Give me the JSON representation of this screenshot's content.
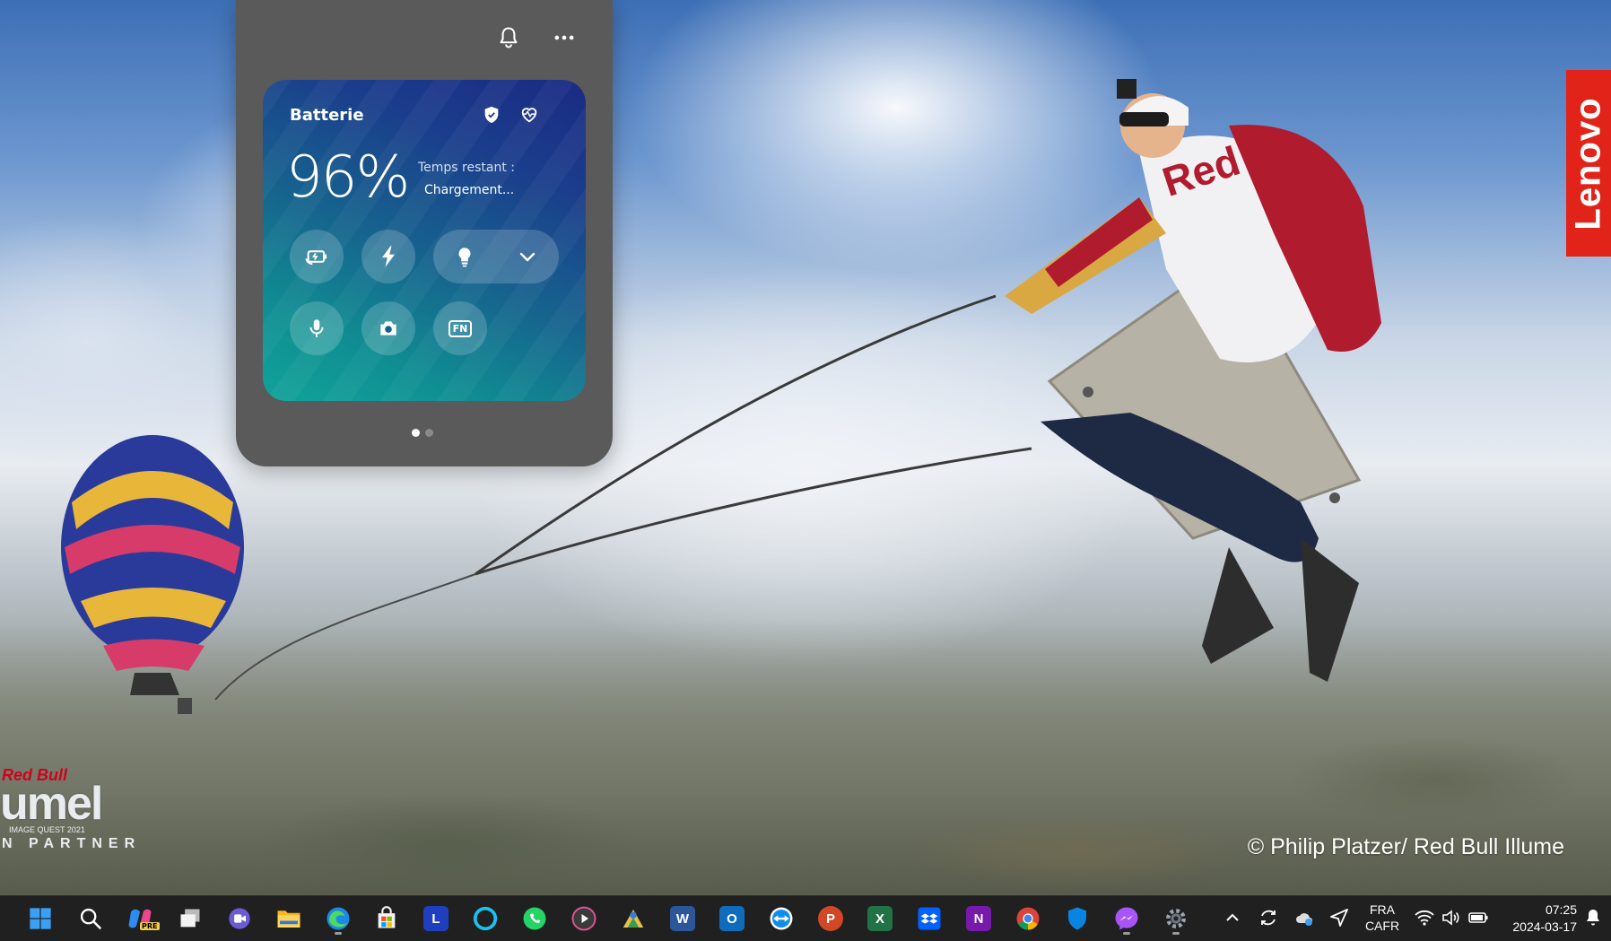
{
  "wallpaper": {
    "brand_tab": "Lenovo",
    "credit": "© Philip Platzer/ Red Bull Illume",
    "logo": {
      "brand": "Red Bull",
      "word": "umel",
      "subtitle": "IMAGE QUEST 2021",
      "partner": "N PARTNER"
    },
    "jersey_text": "Red"
  },
  "widget": {
    "header_icons": [
      "bell-icon",
      "more-icon"
    ],
    "card": {
      "title": "Batterie",
      "title_icons": [
        "shield-icon",
        "heart-pulse-icon"
      ],
      "percent": "96%",
      "time_label": "Temps restant :",
      "time_value": "Chargement...",
      "buttons_row1": [
        "battery-mode-icon",
        "rapid-charge-icon",
        "light-bulb-icon",
        "chevron-down-icon"
      ],
      "buttons_row2": [
        "microphone-icon",
        "camera-icon"
      ],
      "fn_label": "FN"
    },
    "pages": 2,
    "active_page": 1
  },
  "taskbar": {
    "apps": [
      {
        "name": "start",
        "icon": "windows-icon"
      },
      {
        "name": "search",
        "icon": "search-icon"
      },
      {
        "name": "copilot",
        "icon": "copilot-icon",
        "label": "PRE"
      },
      {
        "name": "task-view",
        "icon": "task-view-icon"
      },
      {
        "name": "teams-chat",
        "icon": "chat-icon"
      },
      {
        "name": "file-explorer",
        "icon": "folder-icon"
      },
      {
        "name": "edge",
        "icon": "edge-icon"
      },
      {
        "name": "store",
        "icon": "store-icon"
      },
      {
        "name": "lenovo-vantage",
        "icon": "lenovo-l-icon",
        "label": "L"
      },
      {
        "name": "alexa",
        "icon": "ring-icon"
      },
      {
        "name": "whatsapp",
        "icon": "whatsapp-icon"
      },
      {
        "name": "media-player",
        "icon": "play-icon"
      },
      {
        "name": "map-app",
        "icon": "pin-icon"
      },
      {
        "name": "word",
        "icon": "word-icon",
        "label": "W"
      },
      {
        "name": "outlook",
        "icon": "outlook-icon",
        "label": "O"
      },
      {
        "name": "teamviewer",
        "icon": "teamviewer-icon"
      },
      {
        "name": "powerpoint",
        "icon": "powerpoint-icon",
        "label": "P"
      },
      {
        "name": "excel",
        "icon": "excel-icon",
        "label": "X"
      },
      {
        "name": "dropbox",
        "icon": "dropbox-icon"
      },
      {
        "name": "onenote",
        "icon": "onenote-icon",
        "label": "N"
      },
      {
        "name": "chrome",
        "icon": "chrome-icon"
      },
      {
        "name": "defender",
        "icon": "shield-icon"
      },
      {
        "name": "messenger",
        "icon": "messenger-icon"
      },
      {
        "name": "settings",
        "icon": "gear-icon"
      }
    ],
    "tray": {
      "language_top": "FRA",
      "language_bottom": "CAFR",
      "time": "07:25",
      "date": "2024-03-17"
    }
  }
}
